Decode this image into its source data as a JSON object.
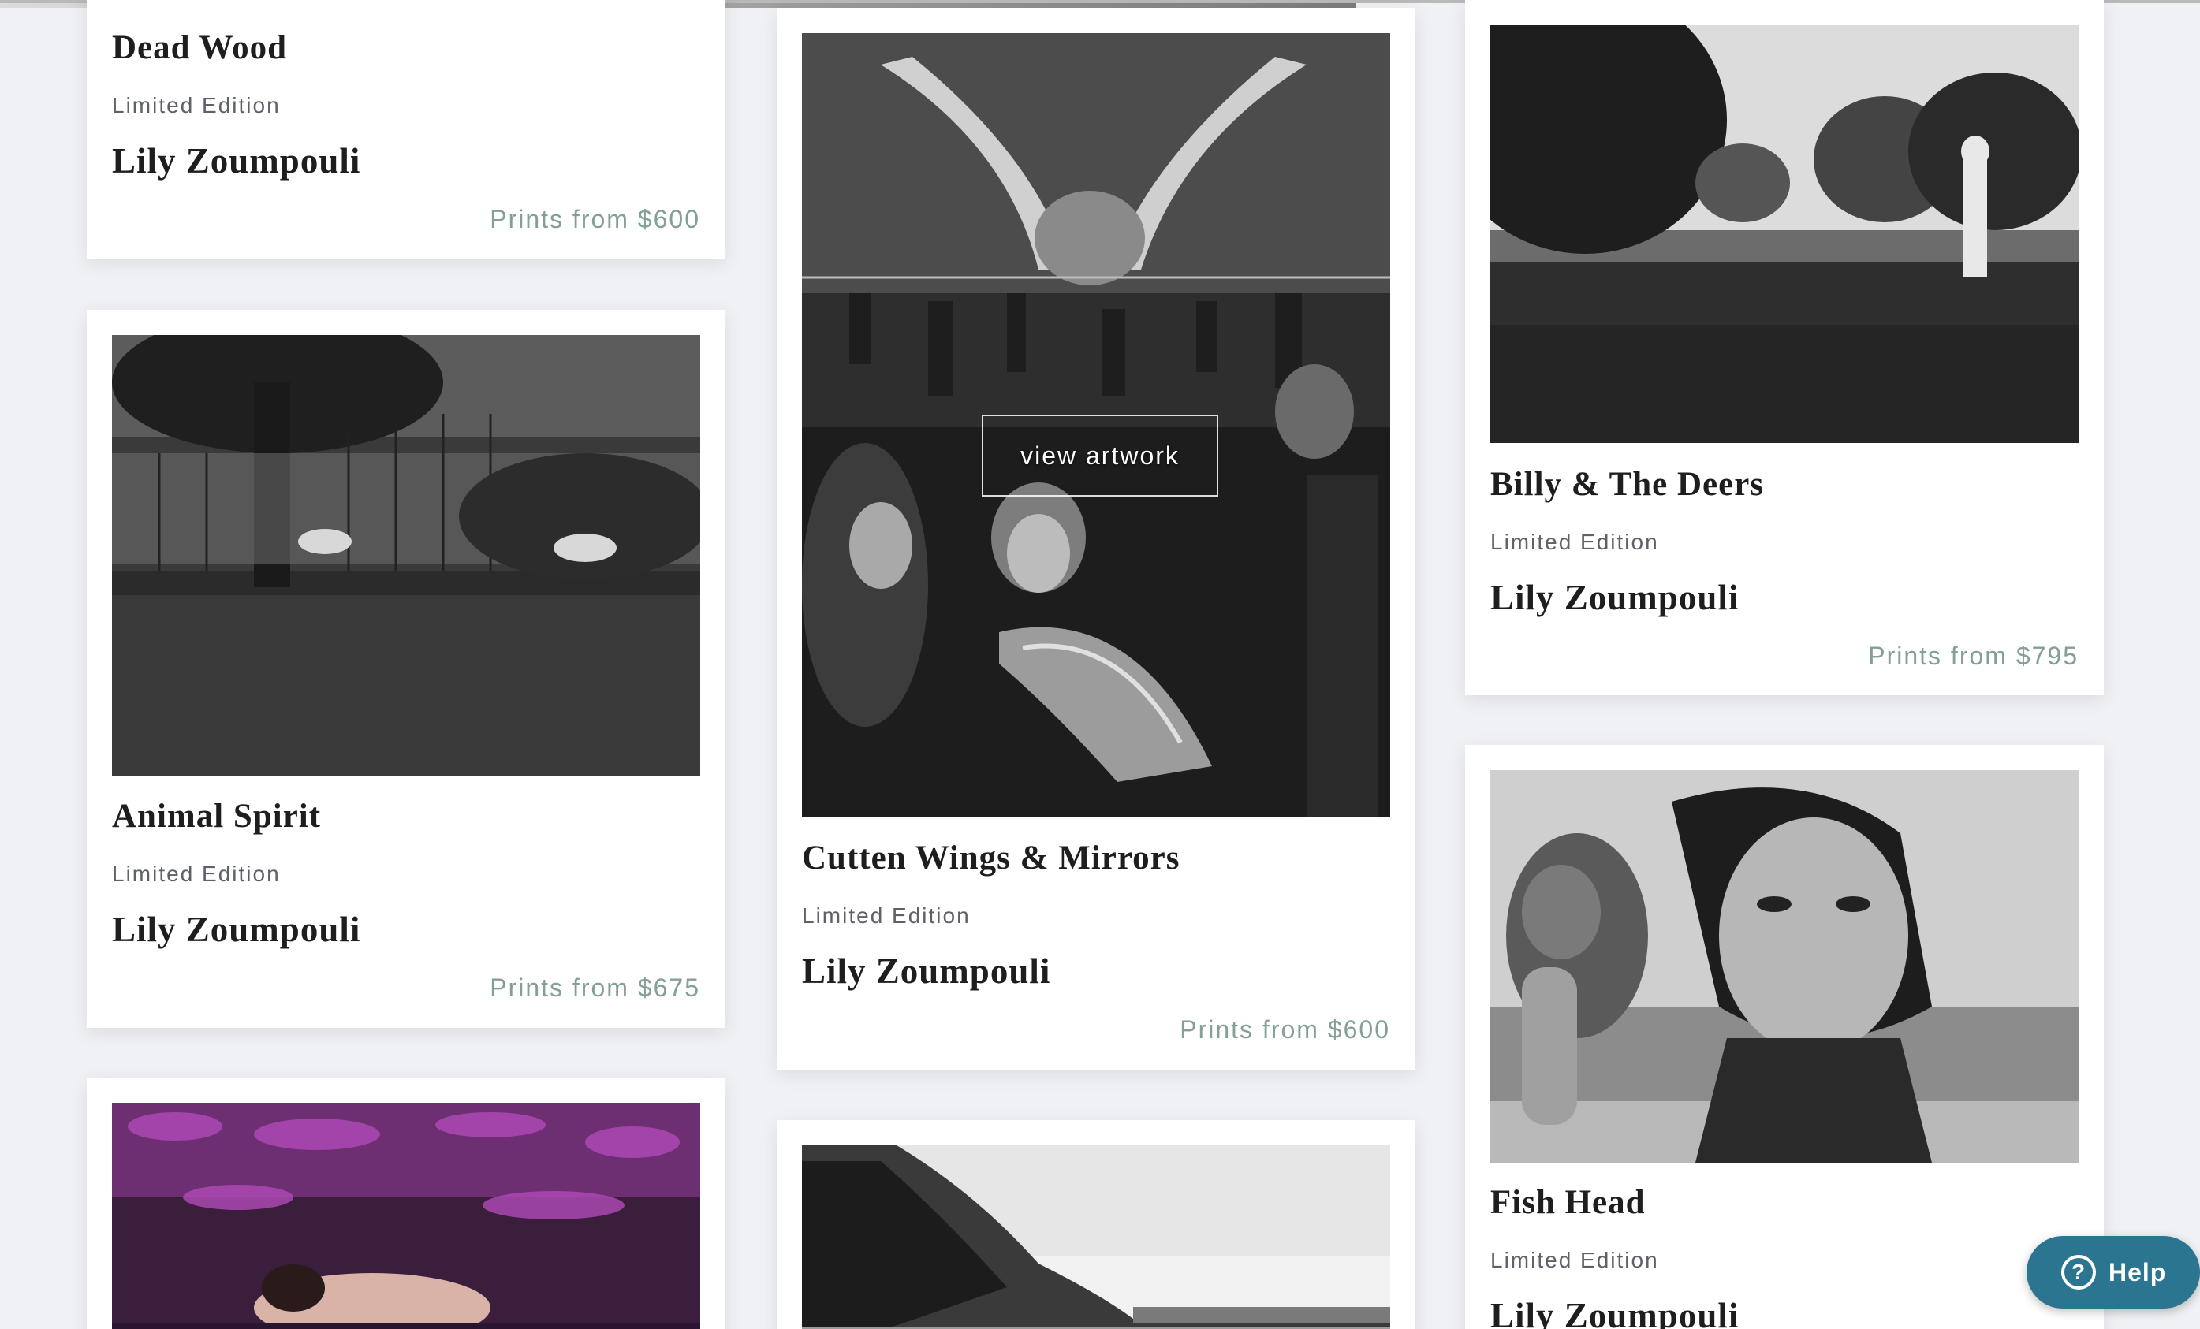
{
  "cards": {
    "dead_wood": {
      "title": "Dead Wood",
      "edition": "Limited Edition",
      "artist": "Lily Zoumpouli",
      "price": "Prints from $600"
    },
    "animal_spirit": {
      "title": "Animal Spirit",
      "edition": "Limited Edition",
      "artist": "Lily Zoumpouli",
      "price": "Prints from $675"
    },
    "cutten_wings": {
      "title": "Cutten Wings & Mirrors",
      "edition": "Limited Edition",
      "artist": "Lily Zoumpouli",
      "price": "Prints from $600",
      "overlay": "view artwork"
    },
    "billy": {
      "title": "Billy & The Deers",
      "edition": "Limited Edition",
      "artist": "Lily Zoumpouli",
      "price": "Prints from $795"
    },
    "fish_head": {
      "title": "Fish Head",
      "edition": "Limited Edition",
      "artist": "Lily Zoumpouli"
    }
  },
  "help": {
    "label": "Help",
    "icon": "question-circle-icon"
  },
  "colors": {
    "background": "#f0f1f4",
    "card": "#ffffff",
    "price": "#84a094",
    "help_button": "#2c7591"
  }
}
